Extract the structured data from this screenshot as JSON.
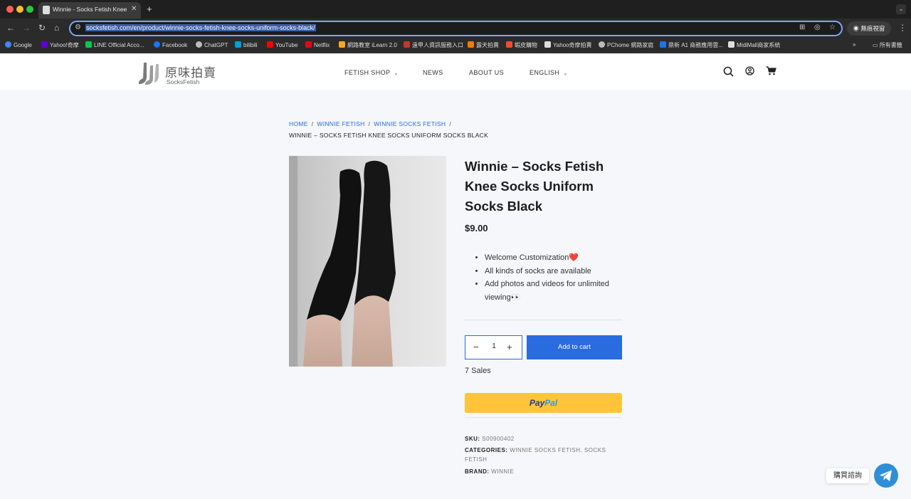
{
  "browser": {
    "tab_title": "Winnie - Socks Fetish Knee S",
    "url": "socksfetish.com/en/product/winnie-socks-fetish-knee-socks-uniform-socks-black/",
    "incognito_label": "無痕視窗",
    "bookmarks": [
      {
        "label": "Google",
        "color": "#4285f4"
      },
      {
        "label": "Yahoo!奇摩",
        "color": "#6001d2"
      },
      {
        "label": "LINE Official Acco...",
        "color": "#06c755"
      },
      {
        "label": "Facebook",
        "color": "#1877f2"
      },
      {
        "label": "ChatGPT",
        "color": "#bbbbbb"
      },
      {
        "label": "bilibili",
        "color": "#00a1d6"
      },
      {
        "label": "YouTube",
        "color": "#ff0000"
      },
      {
        "label": "Netflix",
        "color": "#e50914"
      },
      {
        "label": "網路教室 iLearn 2.0",
        "color": "#f5a623"
      },
      {
        "label": "遠甲人資訊服務入口",
        "color": "#c0392b"
      },
      {
        "label": "露天拍賣",
        "color": "#f07c00"
      },
      {
        "label": "蝦皮購物",
        "color": "#ee4d2d"
      },
      {
        "label": "Yahoo奇摩拍賣",
        "color": "#dddddd"
      },
      {
        "label": "PChome 網路家庭",
        "color": "#bbbbbb"
      },
      {
        "label": "鼎新 A1 商務應用雲...",
        "color": "#1a73e8"
      },
      {
        "label": "MidiMall商家系統",
        "color": "#dddddd"
      }
    ],
    "all_bookmarks_label": "所有書籤"
  },
  "site": {
    "logo_cn": "原味拍賣",
    "logo_en": "SocksFetish",
    "menu": {
      "shop": "FETISH SHOP",
      "news": "NEWS",
      "about": "ABOUT US",
      "lang": "ENGLISH"
    }
  },
  "breadcrumb": {
    "home": "HOME",
    "cat1": "WINNIE FETISH",
    "cat2": "WINNIE SOCKS FETISH",
    "current": "WINNIE – SOCKS FETISH KNEE SOCKS UNIFORM SOCKS BLACK",
    "sep": "/"
  },
  "product": {
    "title": "Winnie – Socks Fetish Knee Socks Uniform Socks Black",
    "price": "$9.00",
    "features": [
      "Welcome Customization❤️",
      "All kinds of socks are available",
      "Add photos and videos for unlimited viewing👀"
    ],
    "qty_minus": "−",
    "qty_plus": "+",
    "qty_value": "1",
    "add_to_cart": "Add to cart",
    "sales": "7 Sales",
    "paypal_a": "Pay",
    "paypal_b": "Pal",
    "sku_label": "SKU:",
    "sku": "S00900402",
    "categories_label": "CATEGORIES:",
    "category_1": "WINNIE SOCKS FETISH",
    "category_sep": ",",
    "category_2": "SOCKS FETISH",
    "brand_label": "BRAND:",
    "brand": "WINNIE"
  },
  "chat": {
    "label": "購買諮詢"
  },
  "colors": {
    "accent": "#2b6be0",
    "paypal_yellow": "#ffc43a",
    "telegram": "#2f8fd6"
  }
}
